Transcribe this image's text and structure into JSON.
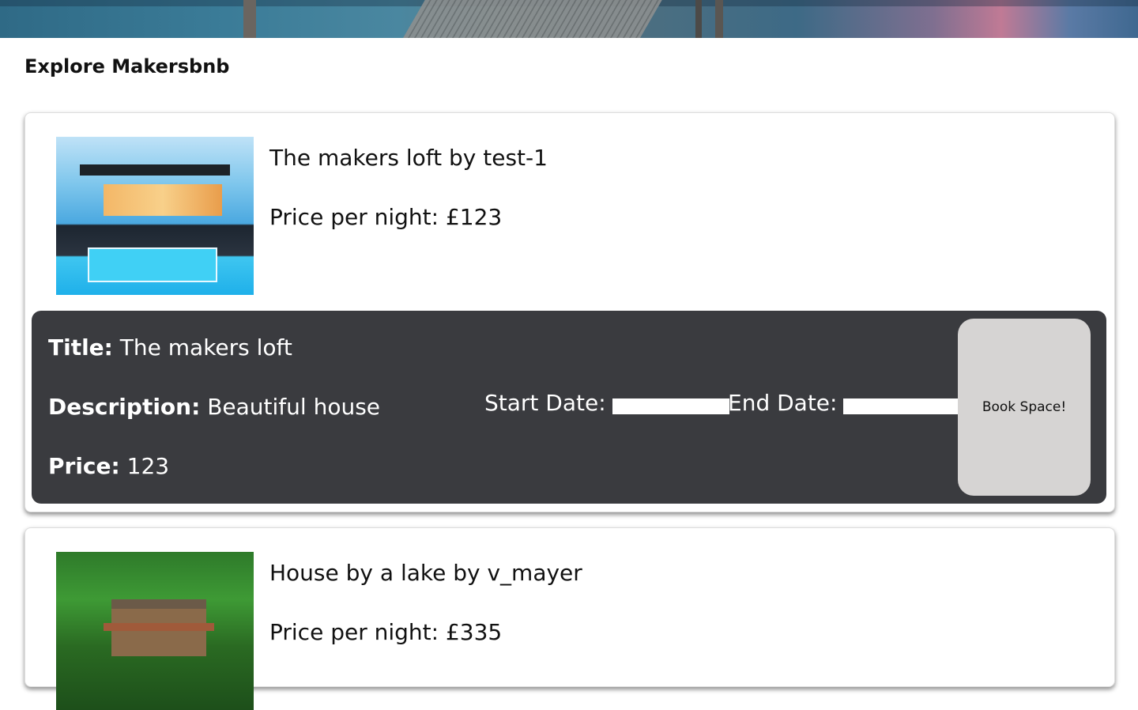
{
  "header": {
    "title": "Explore Makersbnb"
  },
  "listings": [
    {
      "name_line": "The makers loft by test-1",
      "price_line": "Price per night: £123",
      "image": "modern-house-with-pool",
      "details": {
        "title_label": "Title:",
        "title_value": "The makers loft",
        "description_label": "Description:",
        "description_value": "Beautiful house",
        "price_label": "Price:",
        "price_value": "123"
      },
      "booking": {
        "start_label": "Start Date:",
        "start_value": "",
        "end_label": "End Date:",
        "end_value": "",
        "button_label": "Book Space!"
      }
    },
    {
      "name_line": "House by a lake by v_mayer",
      "price_line": "Price per night: £335",
      "image": "lakeside-cabin"
    }
  ]
}
